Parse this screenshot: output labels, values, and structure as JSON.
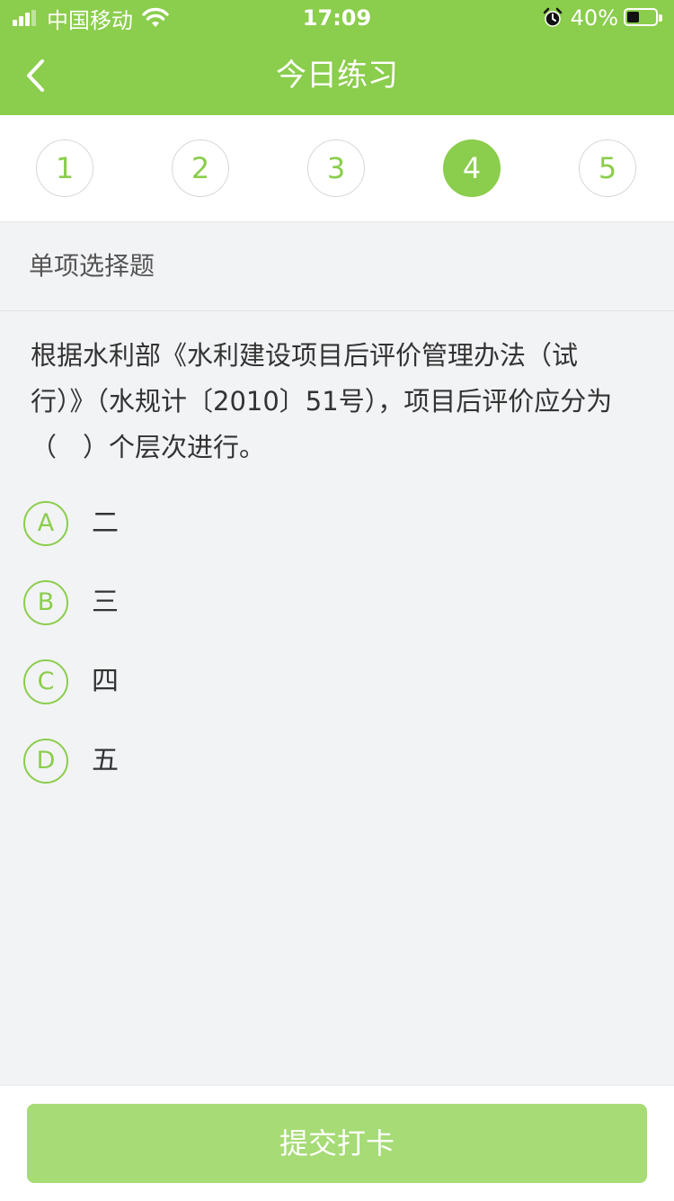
{
  "status_bar": {
    "carrier": "中国移动",
    "time": "17:09",
    "battery_percent": "40%",
    "icons": [
      "signal-icon",
      "wifi-icon",
      "alarm-icon",
      "battery-icon"
    ],
    "battery_level": 0.4
  },
  "nav": {
    "title": "今日练习",
    "back_icon": "chevron-left-icon"
  },
  "steps": {
    "items": [
      "1",
      "2",
      "3",
      "4",
      "5"
    ],
    "active": "4"
  },
  "question": {
    "type_label": "单项选择题",
    "lines": [
      "根据水利部《水利建设项目后评价管理办法（试",
      "行）》（水规计〔2010〕51号），项目后评价应分为",
      "（　）个层次进行。"
    ],
    "options": [
      {
        "letter": "A",
        "text": "二"
      },
      {
        "letter": "B",
        "text": "三"
      },
      {
        "letter": "C",
        "text": "四"
      },
      {
        "letter": "D",
        "text": "五"
      }
    ]
  },
  "footer": {
    "submit_label": "提交打卡"
  },
  "colors": {
    "accent": "#8bcd4c",
    "button_disabled": "#a6db76",
    "background": "#f2f3f5"
  }
}
